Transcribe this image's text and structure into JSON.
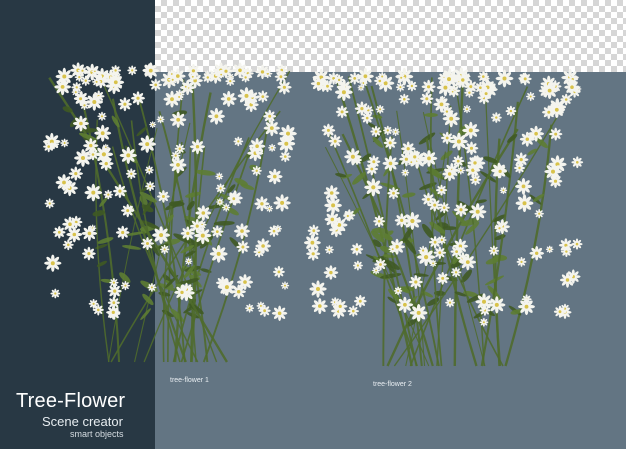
{
  "labels": {
    "plant1": "tree-flower 1",
    "plant2": "tree-flower 2"
  },
  "branding": {
    "title": "Tree-Flower",
    "subtitle": "Scene creator",
    "tagline": "smart objects"
  },
  "colors": {
    "background": "#637583",
    "left_panel": "#283844",
    "transparency_checker": "#d6d6d6",
    "petal": "#f4f4ee",
    "flower_center": "#d8c24a",
    "stem": "#4f6b2c"
  }
}
